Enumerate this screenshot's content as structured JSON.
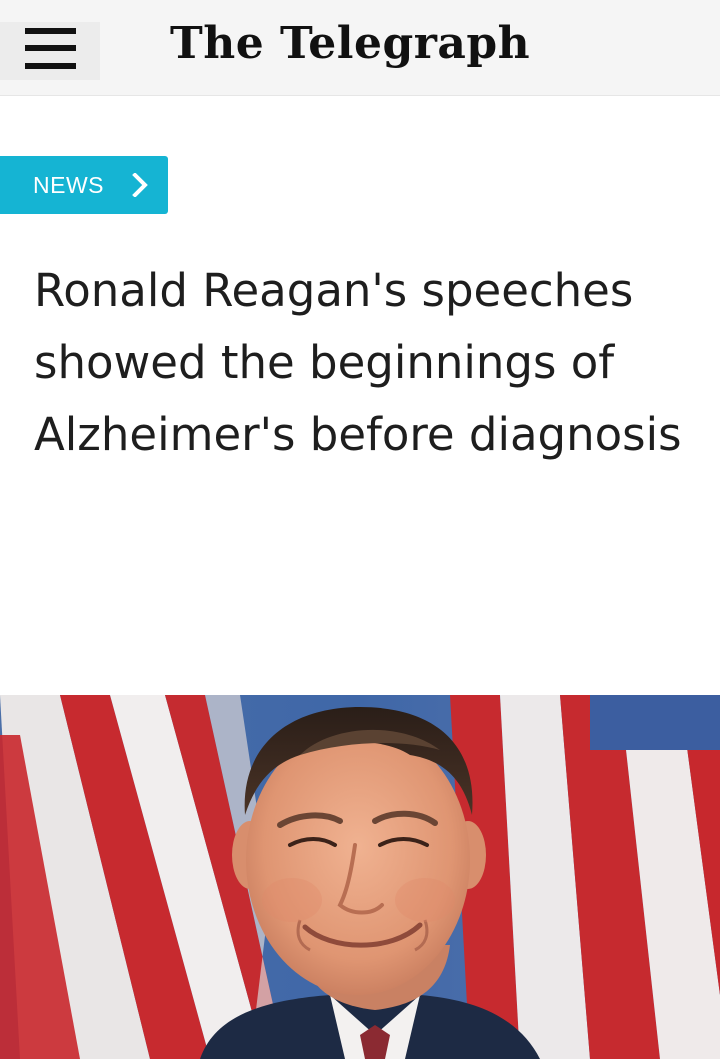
{
  "header": {
    "menu_icon": "hamburger-menu-icon",
    "logo_text": "The Telegraph"
  },
  "article": {
    "section_label": "NEWS",
    "section_icon": "chevron-right-icon",
    "section_color": "#15b4d3",
    "headline": "Ronald Reagan's speeches showed the beginnings of Alzheimer's before diagnosis"
  },
  "hero_image": {
    "subject": "photo"
  }
}
